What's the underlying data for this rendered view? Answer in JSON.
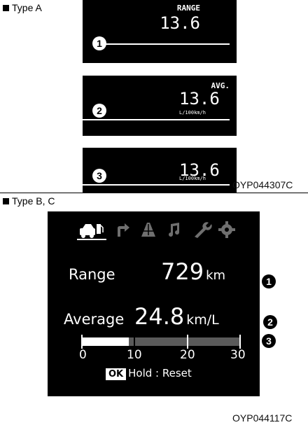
{
  "type_a": {
    "label": "Type A",
    "panel1": {
      "title": "RANGE",
      "value": "13.6",
      "marker": "1"
    },
    "panel2": {
      "title": "AVG.",
      "value": "13.6",
      "unit": "L/100km/h",
      "marker": "2"
    },
    "panel3": {
      "value": "13.6",
      "unit": "L/100km/h",
      "marker": "3"
    },
    "code": "OYP044307C"
  },
  "type_bc": {
    "label": "Type B, C",
    "icons": [
      "fuel-car-icon",
      "turn-arrow-icon",
      "road-icon",
      "music-note-icon",
      "wrench-icon",
      "gear-icon"
    ],
    "range_label": "Range",
    "range_value": "729",
    "range_unit": "km",
    "average_label": "Average",
    "average_value": "24.8",
    "average_unit": "km/L",
    "bar": {
      "scale_max": 30,
      "fill_fraction": 0.3,
      "ticks": [
        "0",
        "10",
        "20",
        "30"
      ]
    },
    "ok_label": "OK",
    "hold_reset": "Hold : Reset",
    "markers": [
      "1",
      "2",
      "3"
    ],
    "code": "OYP044117C"
  },
  "colors": {
    "lcd_background": "#000000",
    "lcd_text": "#ffffff",
    "icon_inactive": "#6f6f6f"
  }
}
